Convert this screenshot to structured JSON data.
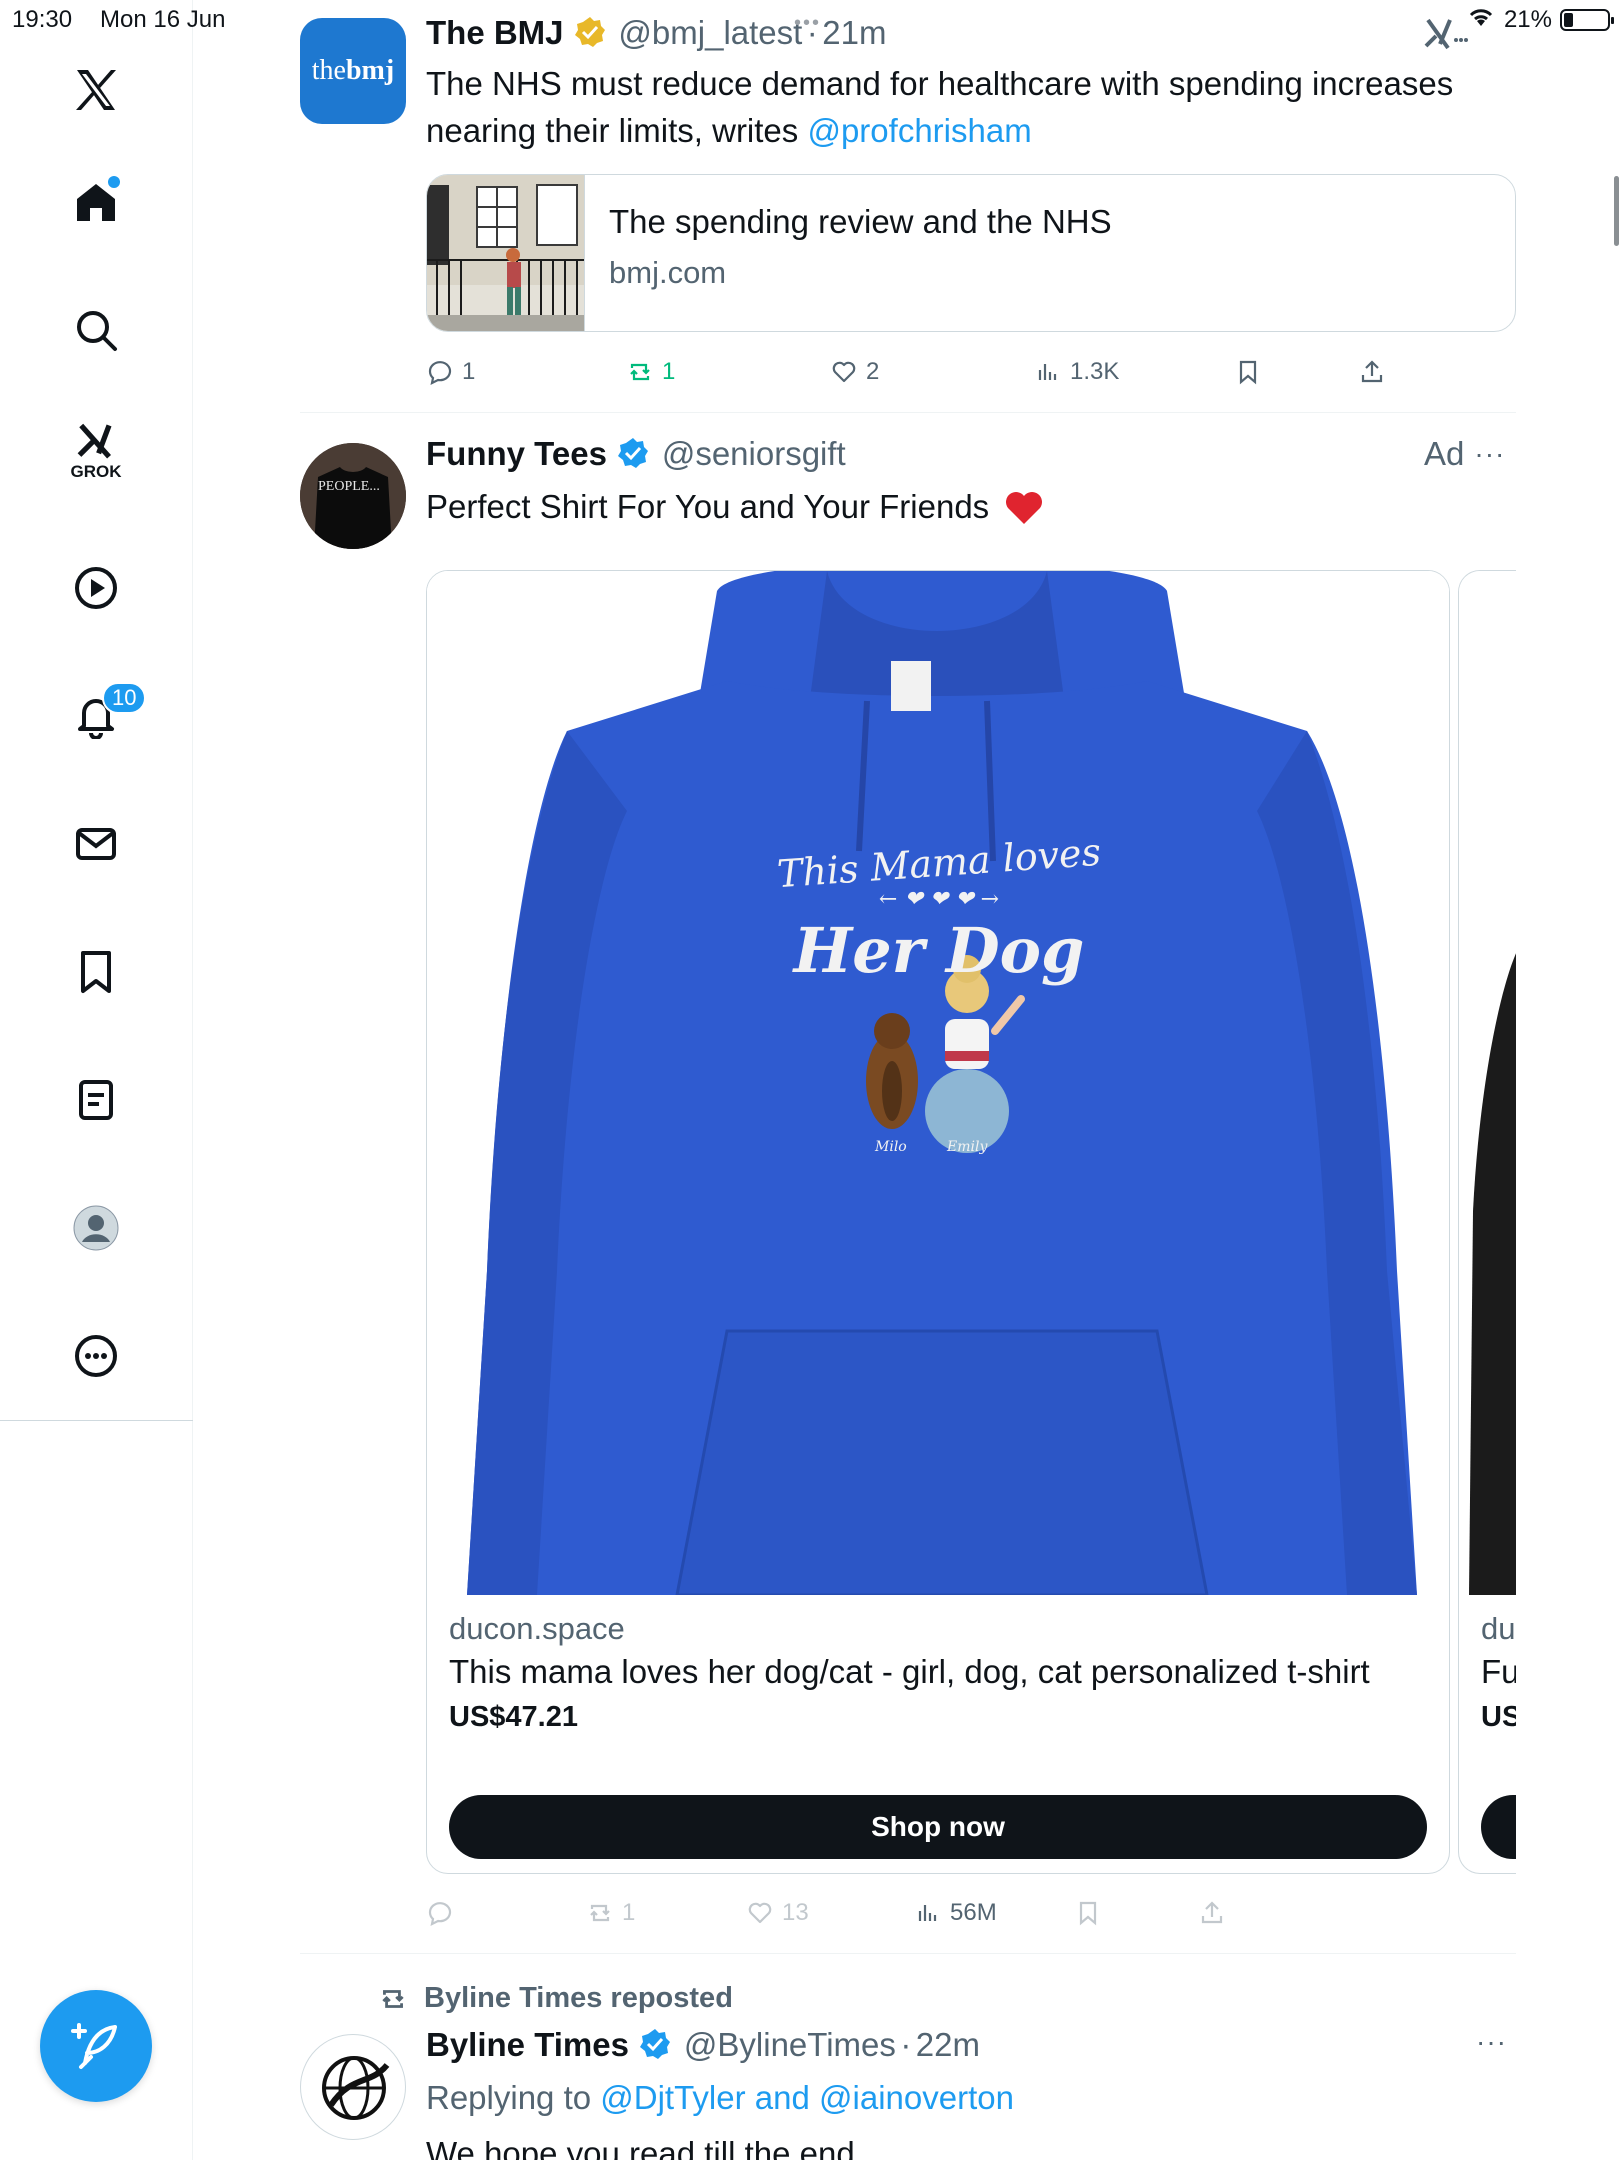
{
  "status": {
    "time": "19:30",
    "date": "Mon 16 Jun",
    "battery": "21%"
  },
  "sidebar": {
    "grok_label": "GROK",
    "notif_count": "10",
    "items": [
      "x-logo",
      "home",
      "explore",
      "grok",
      "video",
      "notifications",
      "messages",
      "bookmarks",
      "lists",
      "profile",
      "more"
    ]
  },
  "tweets": [
    {
      "name": "The BMJ",
      "handle": "@bmj_latest",
      "time": "21m",
      "avatar_text_pre": "the",
      "avatar_text_bold": "bmj",
      "text": "The NHS must reduce demand for healthcare with spending increases nearing their limits, writes ",
      "mention": "@profchrisham",
      "card_title": "The spending review and the NHS",
      "card_domain": "bmj.com",
      "replies": "1",
      "reposts": "1",
      "likes": "2",
      "views": "1.3K"
    },
    {
      "name": "Funny Tees",
      "handle": "@seniorsgift",
      "ad_label": "Ad",
      "avatar_text": "PEOPLE...",
      "text": "Perfect Shirt For You and Your Friends",
      "card": {
        "domain": "ducon.space",
        "title": "This mama loves her dog/cat - girl, dog, cat personalized t-shirt",
        "price": "US$47.21",
        "cta": "Shop now",
        "design_line1": "This Mama loves",
        "design_line2": "Her Dog",
        "pet_name": "Milo",
        "person_name": "Emily"
      },
      "card2": {
        "domain": "ducon.space",
        "title": "Funny",
        "price": "US$"
      },
      "reposts": "1",
      "likes": "13",
      "views": "56M"
    },
    {
      "repost_by": "Byline Times reposted",
      "name": "Byline Times",
      "handle": "@BylineTimes",
      "time": "22m",
      "reply_prefix": "Replying to ",
      "reply_to": "@DjtTyler and @iainoverton",
      "text": "We hope you read till the end"
    }
  ],
  "colors": {
    "accent": "#1d9bf0",
    "repost_green": "#00ba7c",
    "hoodie_blue": "#2f5bd0",
    "gold_badge": "#e8b829"
  }
}
